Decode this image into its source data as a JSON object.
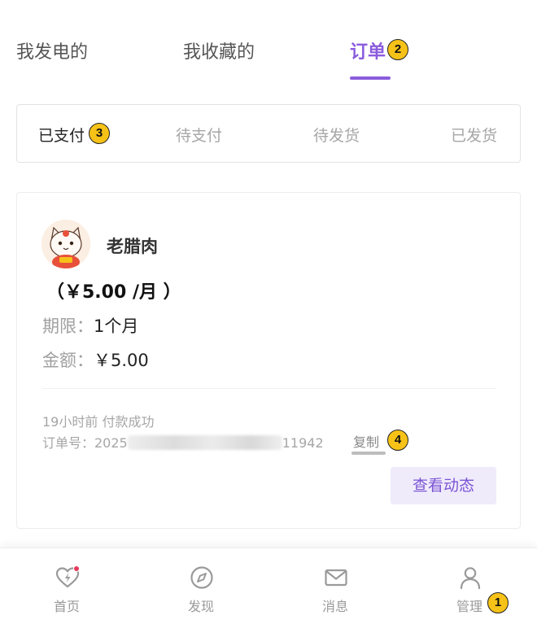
{
  "top_tabs": [
    {
      "label": "我发电的"
    },
    {
      "label": "我收藏的"
    },
    {
      "label": "订单",
      "badge": "2",
      "active": true
    }
  ],
  "sub_tabs": [
    {
      "label": "已支付",
      "badge": "3",
      "active": true
    },
    {
      "label": "待支付"
    },
    {
      "label": "待发货"
    },
    {
      "label": "已发货"
    }
  ],
  "order": {
    "shop_name": "老腊肉",
    "price_line": "（￥5.00 /月 ）",
    "period_label": "期限：",
    "period_value": "1个月",
    "amount_label": "金额：",
    "amount_value": "￥5.00",
    "status_line": "19小时前  付款成功",
    "order_no_prefix": "订单号：2025",
    "order_no_suffix": "11942",
    "copy_label": "复制",
    "copy_badge": "4",
    "view_button": "查看动态"
  },
  "bottom_nav": [
    {
      "label": "首页",
      "icon": "heart-bolt-icon"
    },
    {
      "label": "发现",
      "icon": "compass-icon"
    },
    {
      "label": "消息",
      "icon": "mail-icon"
    },
    {
      "label": "管理",
      "icon": "user-icon",
      "badge": "1"
    }
  ],
  "colors": {
    "accent": "#8a5cdc",
    "badge": "#f6c218",
    "view_button_bg": "#efebfb",
    "notification_dot": "#e6395a"
  }
}
